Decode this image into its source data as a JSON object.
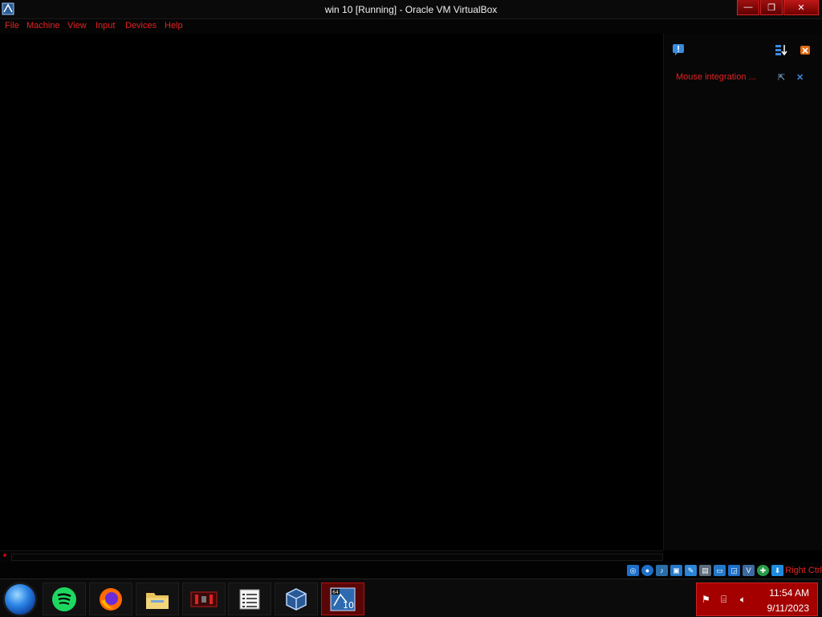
{
  "window": {
    "title": "win 10 [Running] - Oracle VM VirtualBox",
    "controls": {
      "minimize": "—",
      "restore": "❐",
      "close": "✕"
    }
  },
  "menubar": {
    "items": [
      "File",
      "Machine",
      "View",
      "Input",
      "Devices",
      "Help"
    ]
  },
  "notification_panel": {
    "message": "Mouse integration ...",
    "toolbar_icons": [
      "notification-info-icon",
      "sort-icon",
      "close-all-icon"
    ],
    "message_icons": {
      "pin": "⇱",
      "close": "✕"
    }
  },
  "statusbar": {
    "icons": [
      "hard-disk-icon",
      "optical-drive-icon",
      "audio-icon",
      "network-icon",
      "usb-icon",
      "shared-folders-icon",
      "display-icon",
      "recording-icon",
      "cpu-icon",
      "mouse-integration-icon",
      "keyboard-capture-icon"
    ],
    "host_key": "Right Ctrl"
  },
  "taskbar": {
    "apps": [
      "start-orb",
      "spotify",
      "firefox",
      "file-explorer",
      "media-app",
      "notepad",
      "virtualbox-manager",
      "virtualbox-vm-win10"
    ],
    "tray": {
      "icons": [
        "action-center-flag-icon",
        "network-icon",
        "volume-icon"
      ],
      "time": "11:54 AM",
      "date": "9/11/2023"
    }
  },
  "colors": {
    "accent": "#e42222",
    "tray_bg": "#a40000",
    "background": "#000000"
  }
}
